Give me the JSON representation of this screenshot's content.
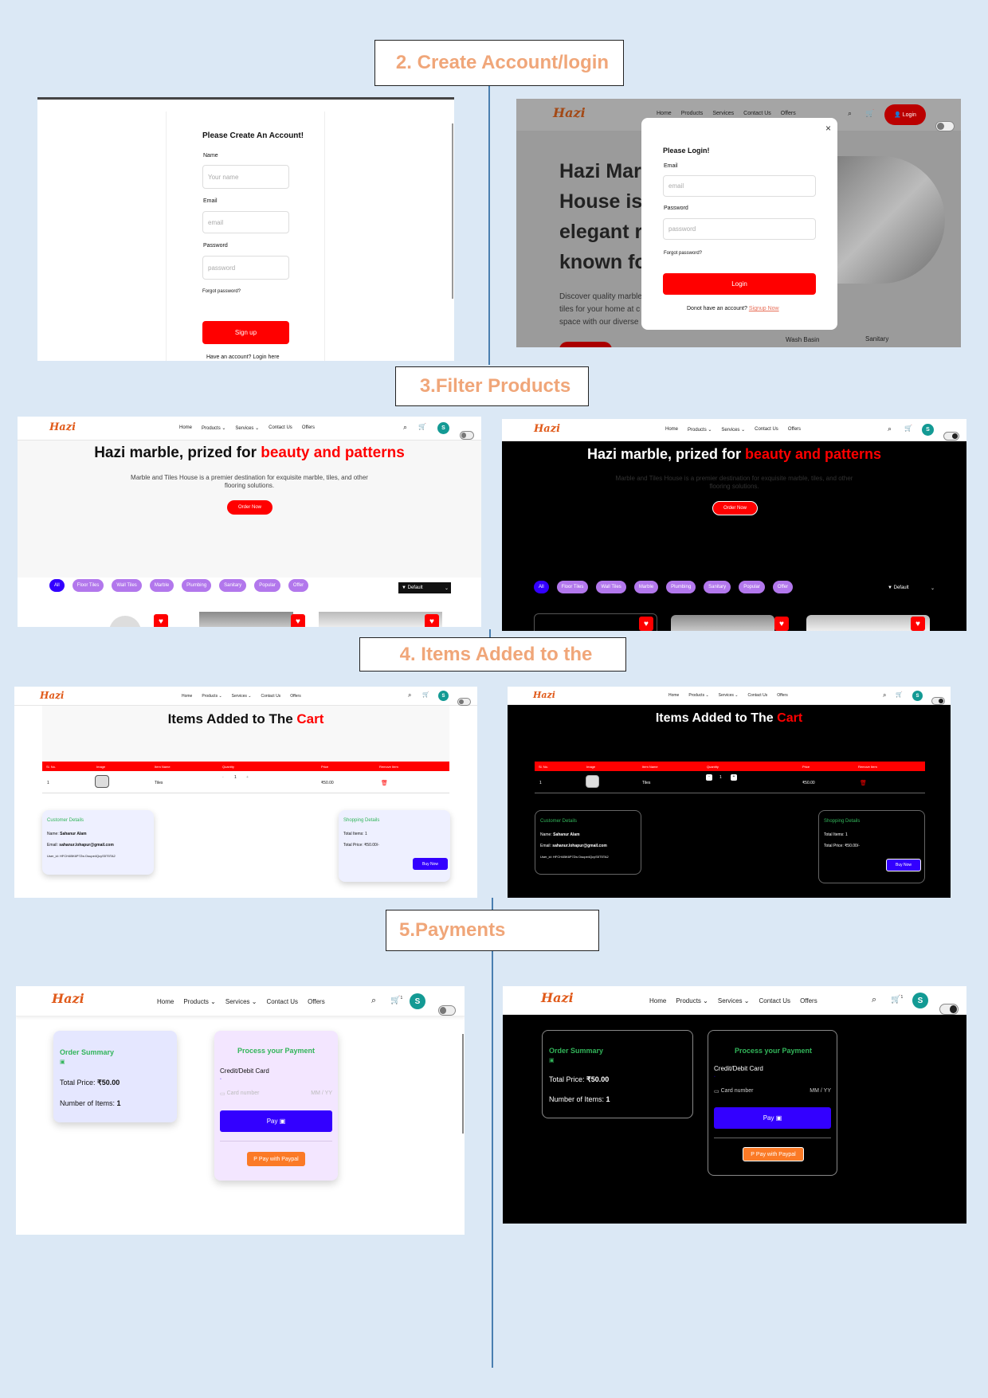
{
  "sections": {
    "s2": "2. Create Account/login",
    "s3": "3.Filter Products",
    "s4": "4. Items Added to the",
    "s5": "5.Payments"
  },
  "nav": {
    "logo": "Hazi",
    "home": "Home",
    "products": "Products",
    "services": "Services",
    "contact": "Contact Us",
    "offers": "Offers",
    "cart_count": "0",
    "cart_count_1": "1",
    "avatar": "S",
    "login": "Login"
  },
  "signup": {
    "heading": "Please Create An Account!",
    "name_label": "Name",
    "name_placeholder": "Your name",
    "email_label": "Email",
    "email_placeholder": "email",
    "password_label": "Password",
    "password_placeholder": "password",
    "forgot": "Forgot password?",
    "button": "Sign up",
    "have_account": "Have an account?",
    "login_here": "Login here"
  },
  "login": {
    "heading": "Please Login!",
    "email_label": "Email",
    "email_placeholder": "email",
    "password_label": "Password",
    "password_placeholder": "password",
    "forgot": "Forgot password?",
    "button": "Login",
    "no_account": "Donot have an account?",
    "signup_now": "Signup Now",
    "close": "×",
    "hero_l1": "Hazi Marb",
    "hero_l2": "House is",
    "hero_l3": "elegant re",
    "hero_l4": "known fo",
    "hero_sub1": "Discover quality marble",
    "hero_sub2": "tiles for your home at c",
    "hero_sub3": "space with our diverse",
    "wash_basin": "Wash Basin",
    "sanitary": "Sanitary"
  },
  "filter": {
    "title_prefix": "Hazi marble, prized for ",
    "title_highlight": "beauty and patterns",
    "sub1": "Marble and Tiles House is a premier destination for exquisite marble, tiles, and other",
    "sub2": "flooring solutions.",
    "order_now": "Order Now",
    "pills": [
      "All",
      "Floor Tiles",
      "Wall Tiles",
      "Marble",
      "Plumbing",
      "Sanitary",
      "Popular",
      "Offer"
    ],
    "sort": "Default"
  },
  "cart": {
    "title_prefix": "Items Added to The ",
    "title_highlight": "Cart",
    "headers": [
      "Sl. No.",
      "Image",
      "Item Name",
      "Quantity",
      "Price",
      "Remove Item"
    ],
    "row": {
      "sl": "1",
      "name": "Tiles",
      "qty": "1",
      "price": "₹50.00"
    },
    "customer_title": "Customer Details",
    "name_label": "Name:",
    "name_value": "Sahanur Alam",
    "email_label": "Email:",
    "email_value": "sahanur.lohapur@gmail.com",
    "userid": "User_id: HFCH4BK6P7Zw Dsupe4QcyS5T5TA2",
    "shopping_title": "Shopping Details",
    "total_items": "Total Items: 1",
    "total_price": "Total Price: ₹50.00/-",
    "buy_now": "Buy Now"
  },
  "payment": {
    "order_summary": "Order Summary",
    "total_price_label": "Total Price:",
    "total_price_value": "₹50.00",
    "items_label": "Number of Items:",
    "items_value": "1",
    "process_title": "Process your Payment",
    "card_label": "Credit/Debit Card",
    "card_placeholder": "Card number",
    "expiry_placeholder": "MM / YY",
    "pay": "Pay",
    "paypal": "Pay with Paypal"
  },
  "icons": [
    "search-icon",
    "cart-icon",
    "heart-icon",
    "trash-icon",
    "filter-icon",
    "chevron-down-icon",
    "card-icon",
    "paypal-icon",
    "close-icon",
    "user-icon"
  ],
  "colors": {
    "accent_red": "#ff0000",
    "accent_blue": "#3300ff",
    "pill_purple": "#b277ec",
    "title_orange": "#f0a679",
    "green": "#32b55a",
    "avatar_teal": "#139a94"
  }
}
